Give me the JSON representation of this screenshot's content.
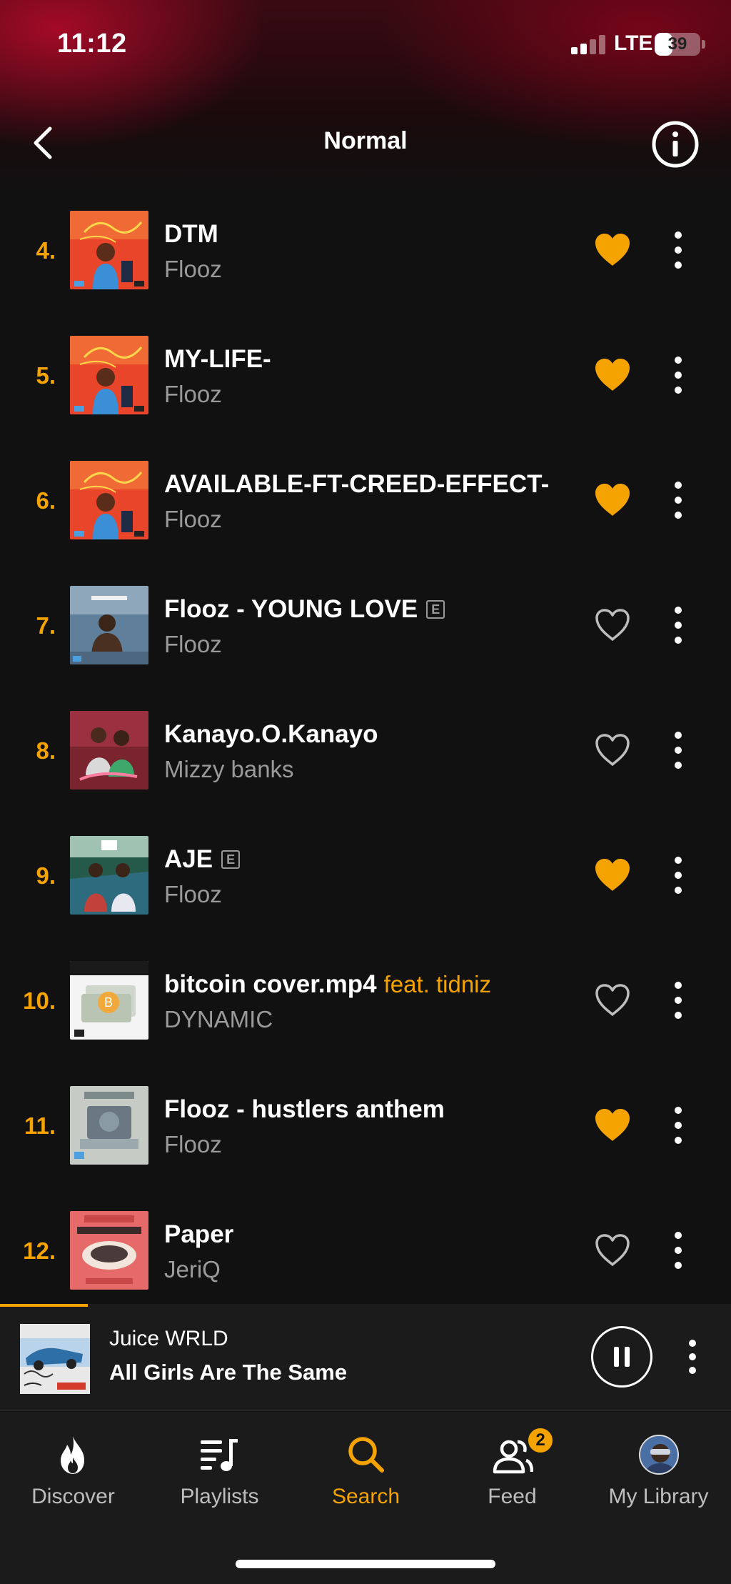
{
  "status_bar": {
    "time": "11:12",
    "network": "LTE",
    "battery": "39",
    "battery_level": 0.39
  },
  "header": {
    "title": "Normal",
    "back_icon": "chevron-left-icon",
    "info_icon": "info-icon"
  },
  "tracks": [
    {
      "index": "4.",
      "title": "DTM",
      "feat": "",
      "explicit": false,
      "artist": "Flooz",
      "liked": true,
      "art": "painful-truth"
    },
    {
      "index": "5.",
      "title": "MY-LIFE-",
      "feat": "",
      "explicit": false,
      "artist": "Flooz",
      "liked": true,
      "art": "painful-truth"
    },
    {
      "index": "6.",
      "title": "AVAILABLE-FT-CREED-EFFECT-",
      "feat": "",
      "explicit": false,
      "artist": "Flooz",
      "liked": true,
      "art": "painful-truth"
    },
    {
      "index": "7.",
      "title": "Flooz - YOUNG LOVE",
      "feat": "",
      "explicit": true,
      "artist": "Flooz",
      "liked": false,
      "art": "young-love"
    },
    {
      "index": "8.",
      "title": "Kanayo.O.Kanayo",
      "feat": "",
      "explicit": false,
      "artist": "Mizzy banks",
      "liked": false,
      "art": "kanayo"
    },
    {
      "index": "9.",
      "title": "AJE",
      "feat": "",
      "explicit": true,
      "artist": "Flooz",
      "liked": true,
      "art": "aje"
    },
    {
      "index": "10.",
      "title": "bitcoin cover.mp4",
      "feat": "feat. tidniz",
      "explicit": false,
      "artist": "DYNAMIC",
      "liked": false,
      "art": "bitcoin"
    },
    {
      "index": "11.",
      "title": "Flooz -  hustlers anthem",
      "feat": "",
      "explicit": false,
      "artist": "Flooz",
      "liked": true,
      "art": "hustlers"
    },
    {
      "index": "12.",
      "title": "Paper",
      "feat": "",
      "explicit": false,
      "artist": "JeriQ",
      "liked": false,
      "art": "paper"
    }
  ],
  "explicit_label": "E",
  "now_playing": {
    "artist": "Juice WRLD",
    "title": "All Girls Are The Same",
    "progress": 0.12
  },
  "tabs": [
    {
      "label": "Discover",
      "icon": "flame-icon",
      "active": false
    },
    {
      "label": "Playlists",
      "icon": "playlist-icon",
      "active": false
    },
    {
      "label": "Search",
      "icon": "search-icon",
      "active": true
    },
    {
      "label": "Feed",
      "icon": "people-icon",
      "active": false,
      "badge": "2"
    },
    {
      "label": "My Library",
      "icon": "avatar-icon",
      "active": false
    }
  ],
  "colors": {
    "accent": "#f5a300",
    "background": "#111111",
    "secondary_text": "#9a9a9a",
    "bar": "#1b1b1b"
  }
}
